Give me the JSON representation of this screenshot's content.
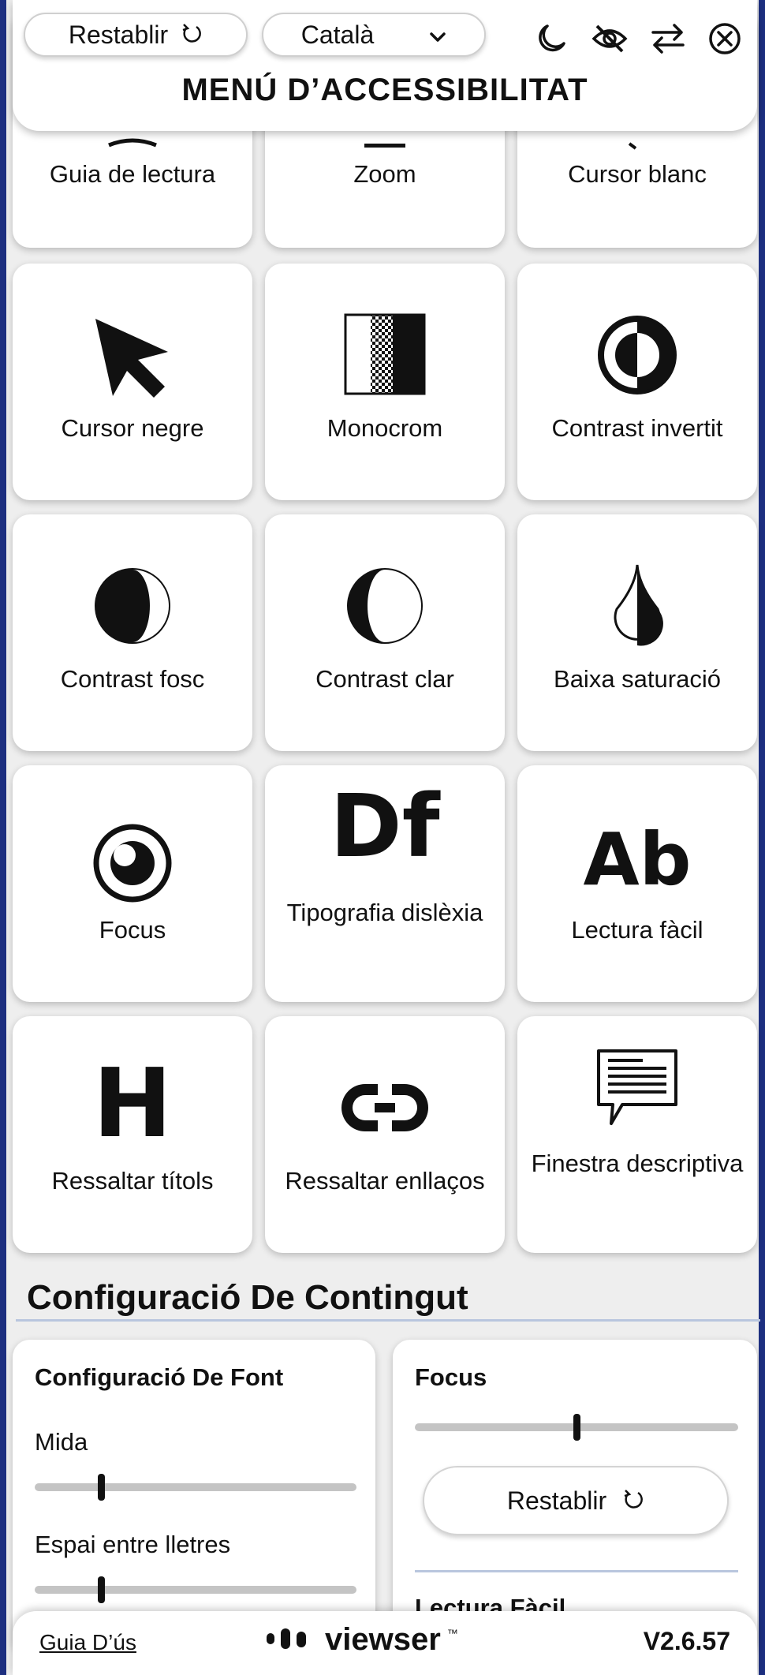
{
  "header": {
    "reset_label": "Restablir",
    "language": "Català",
    "title": "MENÚ D’ACCESSIBILITAT",
    "icons": [
      "moon-icon",
      "hide-icon",
      "swap-icon",
      "close-icon"
    ]
  },
  "tiles": [
    {
      "label": "Guia de lectura",
      "icon": "reading-guide-icon"
    },
    {
      "label": "Zoom",
      "icon": "zoom-icon"
    },
    {
      "label": "Cursor blanc",
      "icon": "white-cursor-icon"
    },
    {
      "label": "Cursor negre",
      "icon": "black-cursor-icon"
    },
    {
      "label": "Monocrom",
      "icon": "monochrome-icon"
    },
    {
      "label": "Contrast invertit",
      "icon": "inverted-contrast-icon"
    },
    {
      "label": "Contrast fosc",
      "icon": "dark-contrast-icon"
    },
    {
      "label": "Contrast clar",
      "icon": "light-contrast-icon"
    },
    {
      "label": "Baixa saturació",
      "icon": "low-saturation-icon"
    },
    {
      "label": "Focus",
      "icon": "focus-icon"
    },
    {
      "label": "Tipografia dislèxia",
      "icon": "dyslexia-font-icon",
      "glyph": "Df"
    },
    {
      "label": "Lectura fàcil",
      "icon": "easy-reading-icon",
      "glyph": "Ab"
    },
    {
      "label": "Ressaltar títols",
      "icon": "highlight-titles-icon",
      "glyph": "H"
    },
    {
      "label": "Ressaltar enllaços",
      "icon": "highlight-links-icon"
    },
    {
      "label": "Finestra descriptiva",
      "icon": "descriptive-window-icon"
    }
  ],
  "content_settings": {
    "title": "Configuració De Contingut",
    "font_panel": {
      "title": "Configuració De Font",
      "size_label": "Mida",
      "size_level": 0.2,
      "spacing_label": "Espai entre lletres",
      "spacing_level": 0.2
    },
    "focus_panel": {
      "title": "Focus",
      "focus_level": 0.5,
      "reset_label": "Restablir",
      "next_title": "Lectura Fàcil"
    }
  },
  "footer": {
    "guide": "Guia D’ús",
    "brand": "viewser",
    "trademark": "™",
    "version": "V2.6.57"
  }
}
